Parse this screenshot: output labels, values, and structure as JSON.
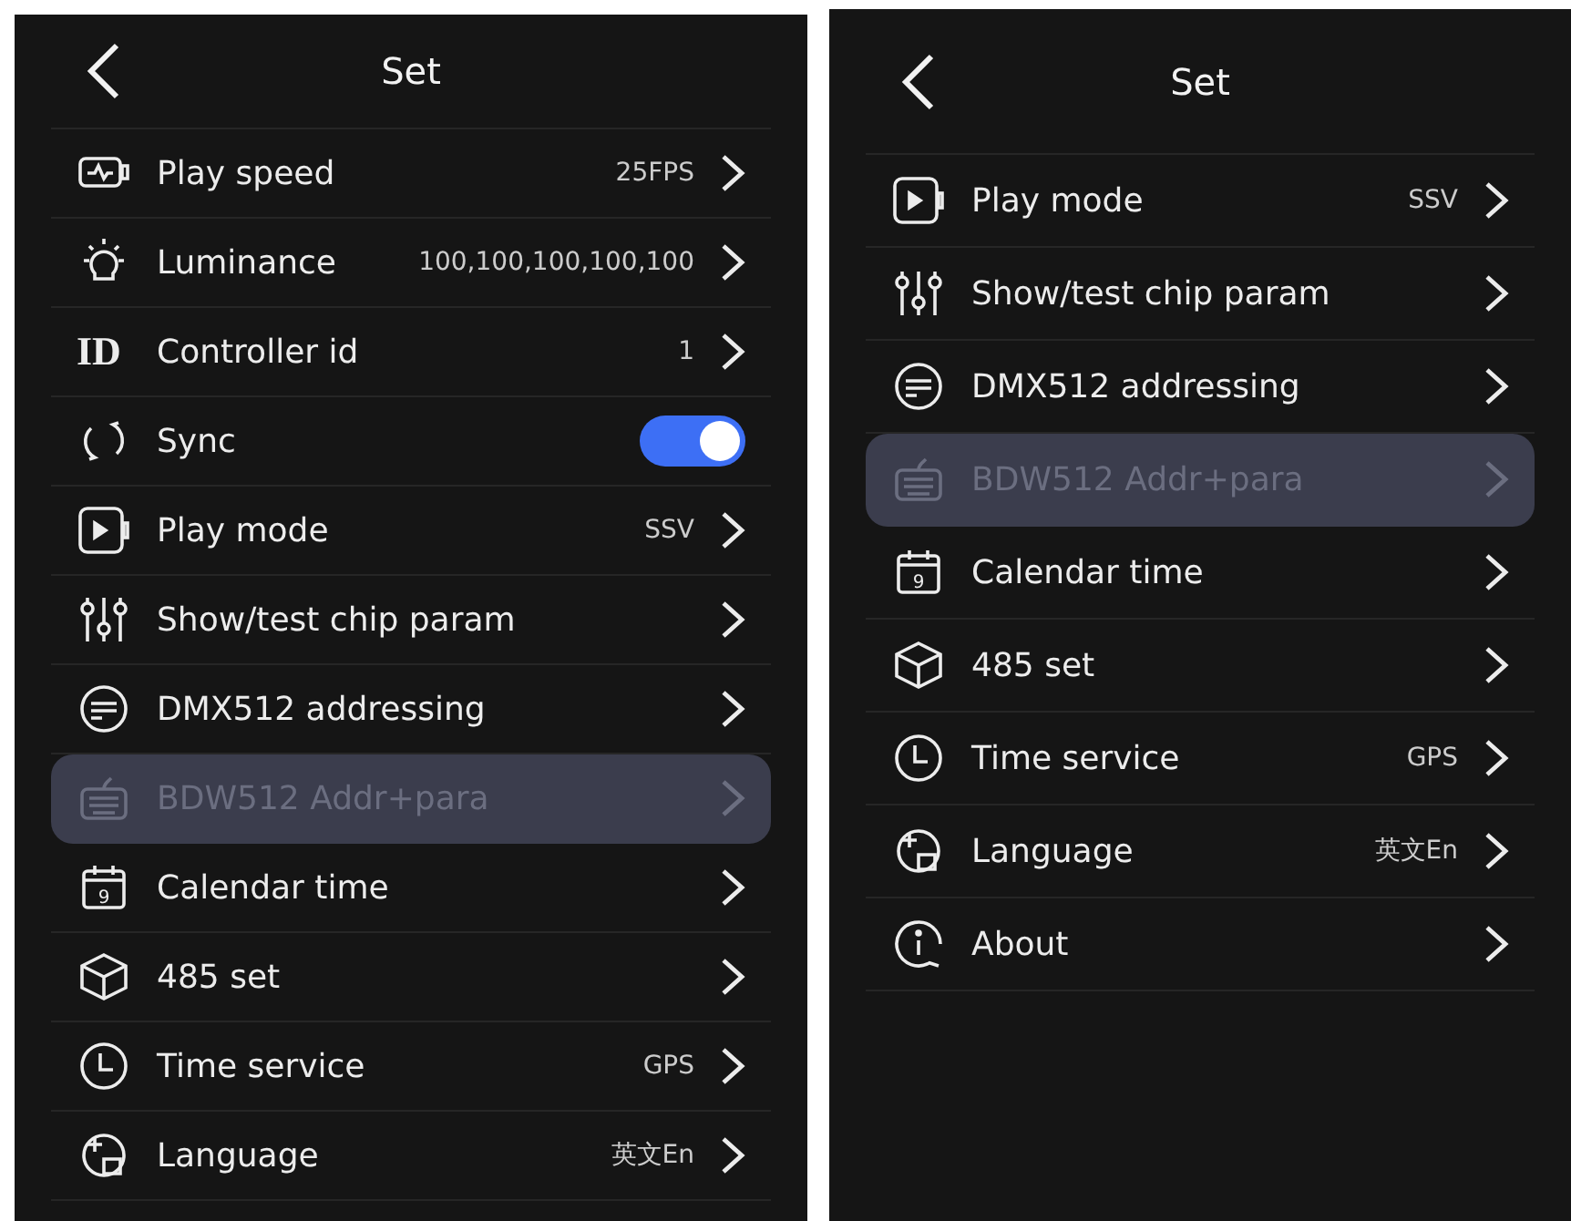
{
  "screens": [
    {
      "title": "Set",
      "items": [
        {
          "kind": "speed",
          "label": "Play speed",
          "value": "25FPS",
          "disabled": false
        },
        {
          "kind": "bulb",
          "label": "Luminance",
          "value": "100,100,100,100,100",
          "disabled": false
        },
        {
          "kind": "id",
          "icon_text": "ID",
          "label": "Controller id",
          "value": "1",
          "disabled": false
        },
        {
          "kind": "sync",
          "label": "Sync",
          "on": true,
          "disabled": false
        },
        {
          "kind": "play",
          "label": "Play mode",
          "value": "SSV",
          "disabled": false
        },
        {
          "kind": "sliders",
          "label": "Show/test chip param",
          "disabled": false
        },
        {
          "kind": "dmx",
          "label": "DMX512 addressing",
          "disabled": false
        },
        {
          "kind": "keyboard",
          "label": "BDW512 Addr+para",
          "disabled": true
        },
        {
          "kind": "calendar",
          "icon_text": "9",
          "label": "Calendar time",
          "disabled": false
        },
        {
          "kind": "cube",
          "label": "485 set",
          "disabled": false
        },
        {
          "kind": "clock",
          "label": "Time service",
          "value": "GPS",
          "disabled": false
        },
        {
          "kind": "language",
          "label": "Language",
          "value": "英文En",
          "disabled": false
        }
      ]
    },
    {
      "title": "Set",
      "items": [
        {
          "kind": "play",
          "label": "Play mode",
          "value": "SSV",
          "disabled": false
        },
        {
          "kind": "sliders",
          "label": "Show/test chip param",
          "disabled": false
        },
        {
          "kind": "dmx",
          "label": "DMX512 addressing",
          "disabled": false
        },
        {
          "kind": "keyboard",
          "label": "BDW512 Addr+para",
          "disabled": true
        },
        {
          "kind": "calendar",
          "icon_text": "9",
          "label": "Calendar time",
          "disabled": false
        },
        {
          "kind": "cube",
          "label": "485 set",
          "disabled": false
        },
        {
          "kind": "clock",
          "label": "Time service",
          "value": "GPS",
          "disabled": false
        },
        {
          "kind": "language",
          "label": "Language",
          "value": "英文En",
          "disabled": false
        },
        {
          "kind": "info",
          "label": "About",
          "disabled": false
        }
      ]
    }
  ]
}
